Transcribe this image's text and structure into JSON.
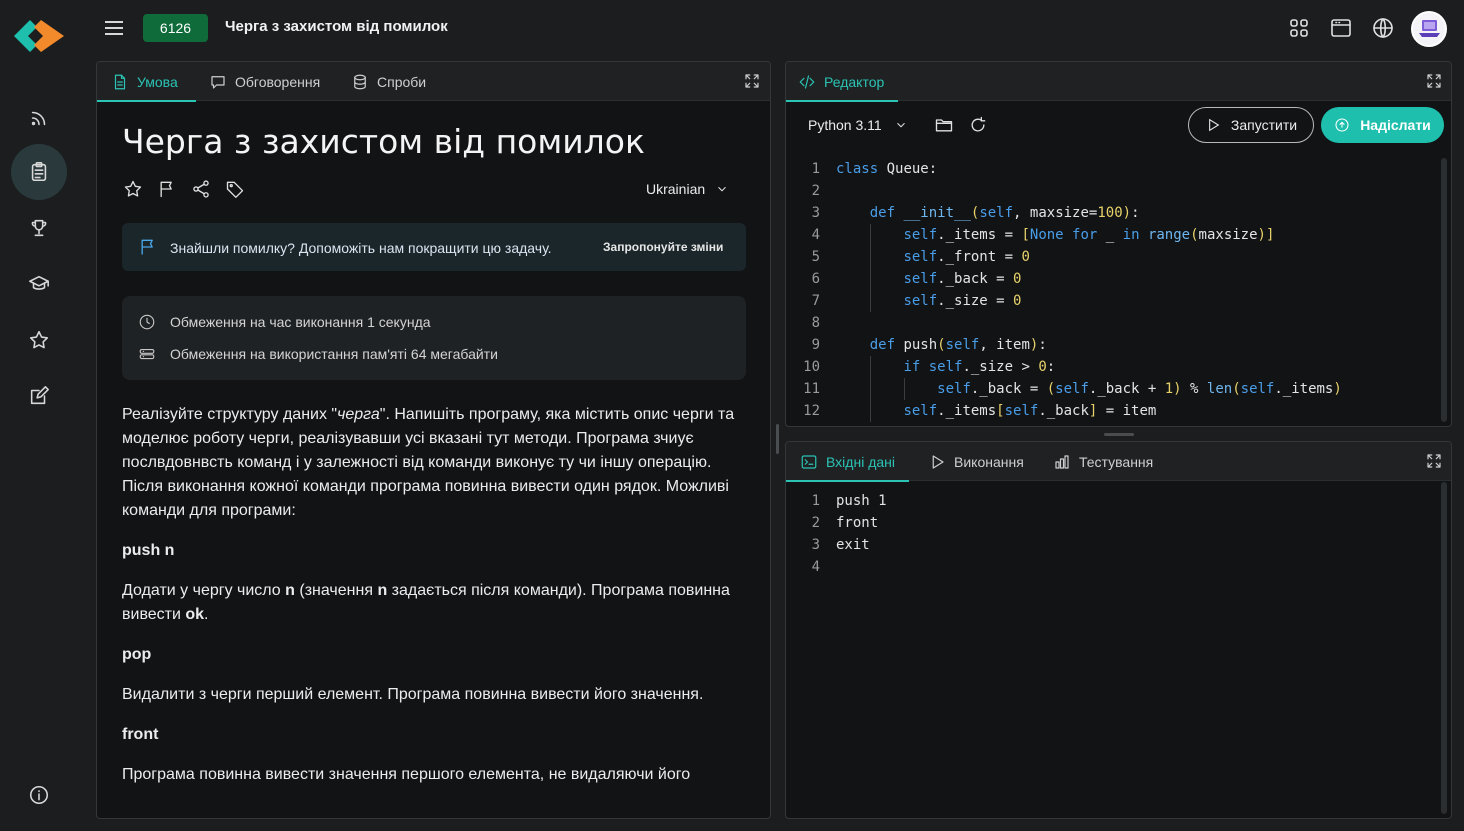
{
  "header": {
    "problem_id": "6126",
    "title": "Черга з захистом від помилок"
  },
  "problem_panel": {
    "tabs": [
      {
        "label": "Умова"
      },
      {
        "label": "Обговорення"
      },
      {
        "label": "Спроби"
      }
    ],
    "title": "Черга з захистом від помилок",
    "language": "Ukrainian",
    "feedback": {
      "text": "Знайшли помилку? Допоможіть нам покращити цю задачу.",
      "link": "Запропонуйте зміни"
    },
    "limits": {
      "time": "Обмеження на час виконання 1 секунда",
      "memory": "Обмеження на використання пам'яті 64 мегабайти"
    },
    "description": {
      "intro_before": "Реалізуйте структуру даних \"",
      "intro_em": "черга",
      "intro_after": "\". Напишіть програму, яка містить опис черги та моделює роботу черги, реалізувавши усі вказані тут методи. Програма зчиує послвдовнвсть команд і у залежності від команди виконує ту чи іншу операцію. Після виконання кожної команди програма повинна вивести один рядок. Можливі команди для програми:",
      "cmd_push": "push n",
      "push_desc_1": "Додати у чергу число ",
      "push_desc_n1": "n",
      "push_desc_2": " (значення ",
      "push_desc_n2": "n",
      "push_desc_3": " задається після команди). Програма повинна вивести ",
      "push_desc_ok": "ok",
      "push_desc_4": ".",
      "cmd_pop": "pop",
      "pop_desc": "Видалити з черги перший елемент. Програма повинна вивести його значення.",
      "cmd_front": "front",
      "front_desc": "Програма повинна вивести значення першого елемента, не видаляючи його"
    }
  },
  "editor_panel": {
    "tab": "Редактор",
    "language": "Python 3.11",
    "run_label": "Запустити",
    "submit_label": "Надіслати",
    "code_lines": [
      "class Queue:",
      "",
      "    def __init__(self, maxsize=100):",
      "        self._items = [None for _ in range(maxsize)]",
      "        self._front = 0",
      "        self._back = 0",
      "        self._size = 0",
      "",
      "    def push(self, item):",
      "        if self._size > 0:",
      "            self._back = (self._back + 1) % len(self._items)",
      "        self._items[self._back] = item"
    ]
  },
  "io_panel": {
    "tabs": [
      {
        "label": "Вхідні дані"
      },
      {
        "label": "Виконання"
      },
      {
        "label": "Тестування"
      }
    ],
    "input_lines": [
      "push 1",
      "front",
      "exit",
      ""
    ]
  },
  "colors": {
    "accent": "#2bc4b4",
    "submit": "#1fbfad",
    "badge": "#0f6b3a",
    "keyword": "#4a9de8",
    "number": "#e8d26a"
  }
}
